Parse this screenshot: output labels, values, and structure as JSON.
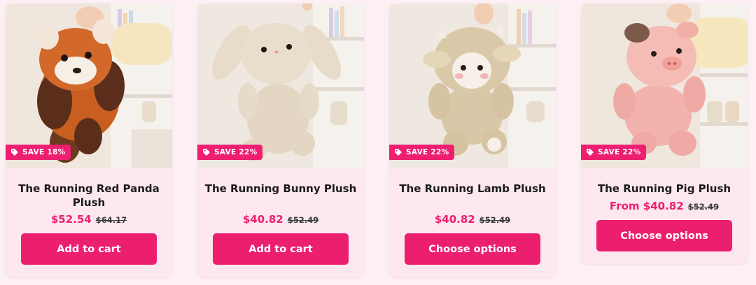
{
  "accent_color": "#ee1e71",
  "card_bg": "#fde8f0",
  "products": [
    {
      "image_name": "red-panda-plush-image",
      "badge": "SAVE 18%",
      "title": "The Running Red Panda Plush",
      "price_prefix": "",
      "price": "$52.54",
      "compare_price": "$64.17",
      "button": "Add to cart"
    },
    {
      "image_name": "bunny-plush-image",
      "badge": "SAVE 22%",
      "title": "The Running Bunny Plush",
      "price_prefix": "",
      "price": "$40.82",
      "compare_price": "$52.49",
      "button": "Add to cart"
    },
    {
      "image_name": "lamb-plush-image",
      "badge": "SAVE 22%",
      "title": "The Running Lamb Plush",
      "price_prefix": "",
      "price": "$40.82",
      "compare_price": "$52.49",
      "button": "Choose options"
    },
    {
      "image_name": "pig-plush-image",
      "badge": "SAVE 22%",
      "title": "The Running Pig Plush",
      "price_prefix": "From",
      "price": "$40.82",
      "compare_price": "$52.49",
      "button": "Choose options"
    }
  ]
}
